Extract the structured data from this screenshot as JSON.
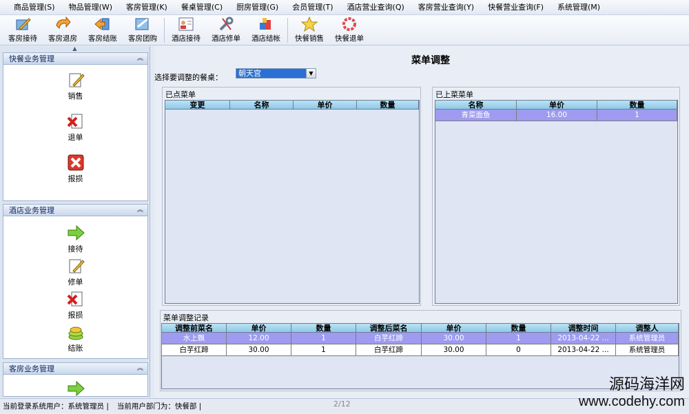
{
  "menu": [
    "商品管理(S)",
    "物品管理(W)",
    "客房管理(K)",
    "餐桌管理(C)",
    "厨房管理(G)",
    "会员管理(T)",
    "酒店营业查询(Q)",
    "客房营业查询(Y)",
    "快餐营业查询(F)",
    "系统管理(M)"
  ],
  "toolbar": [
    {
      "label": "客房接待",
      "icon": "pencil-notepad-icon"
    },
    {
      "label": "客房退房",
      "icon": "return-arrow-icon"
    },
    {
      "label": "客房结账",
      "icon": "checkout-arrow-icon"
    },
    {
      "label": "客房团购",
      "icon": "group-buy-icon"
    },
    {
      "label": "酒店接待",
      "icon": "person-card-icon"
    },
    {
      "label": "酒店修单",
      "icon": "wrench-icon"
    },
    {
      "label": "酒店结帐",
      "icon": "checkout-boxes-icon"
    },
    {
      "label": "快餐销售",
      "icon": "star-icon"
    },
    {
      "label": "快餐退单",
      "icon": "cancel-ring-icon"
    }
  ],
  "sidebar": {
    "fast_food": {
      "title": "快餐业务管理",
      "items": [
        "销售",
        "退单",
        "报损"
      ]
    },
    "hotel": {
      "title": "酒店业务管理",
      "items": [
        "接待",
        "修单",
        "报损",
        "结账"
      ]
    },
    "room": {
      "title": "客房业务管理"
    }
  },
  "main": {
    "title": "菜单调整",
    "table_prompt": "选择要调整的餐桌：",
    "table_select": "朝天宫",
    "ordered": {
      "title": "已点菜单",
      "columns": [
        "变更",
        "名称",
        "单价",
        "数量"
      ]
    },
    "served": {
      "title": "已上菜菜单",
      "columns": [
        "名称",
        "单价",
        "数量"
      ],
      "rows": [
        [
          "青菜面鱼",
          "16.00",
          "1"
        ]
      ]
    },
    "log": {
      "title": "菜单调整记录",
      "columns": [
        "调整前菜名",
        "单价",
        "数量",
        "调整后菜名",
        "单价",
        "数量",
        "调整时间",
        "调整人"
      ],
      "rows": [
        [
          "水上飘",
          "12.00",
          "1",
          "白芋红蹄",
          "30.00",
          "1",
          "2013-04-22 ...",
          "系统管理员"
        ],
        [
          "白芋红蹄",
          "30.00",
          "1",
          "白芋红蹄",
          "30.00",
          "0",
          "2013-04-22 ...",
          "系统管理员"
        ]
      ]
    }
  },
  "status": {
    "user": "当前登录系统用户：系统管理员 |",
    "dept": "当前用户部门为：快餐部 |",
    "pager": "2/12"
  },
  "watermark": {
    "line1": "源码海洋网",
    "line2": "www.codehy.com"
  }
}
